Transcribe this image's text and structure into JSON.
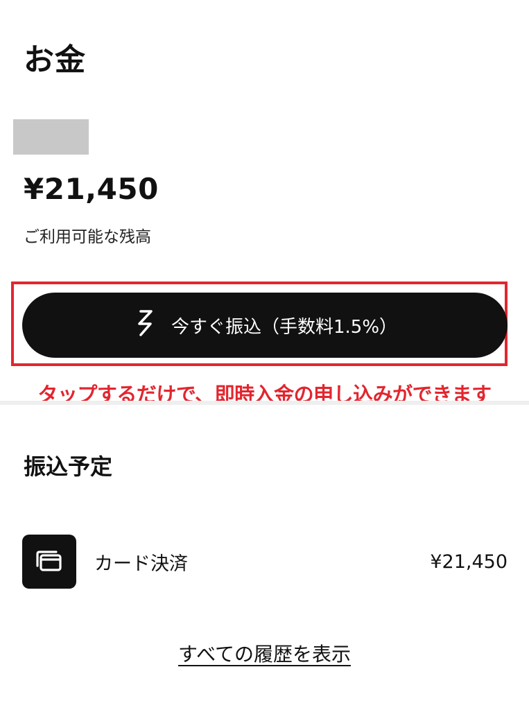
{
  "header": {
    "title": "お金"
  },
  "balance": {
    "amount": "¥21,450",
    "label": "ご利用可能な残高"
  },
  "instant_transfer": {
    "button_label": "今すぐ振込（手数料1.5%）",
    "icon": "lightning-icon",
    "annotation": "タップするだけで、即時入金の申し込みができます",
    "annotation_color": "#e2262f"
  },
  "scheduled": {
    "title": "振込予定",
    "items": [
      {
        "icon": "card-icon",
        "label": "カード決済",
        "amount": "¥21,450"
      }
    ]
  },
  "footer": {
    "history_link": "すべての履歴を表示"
  }
}
